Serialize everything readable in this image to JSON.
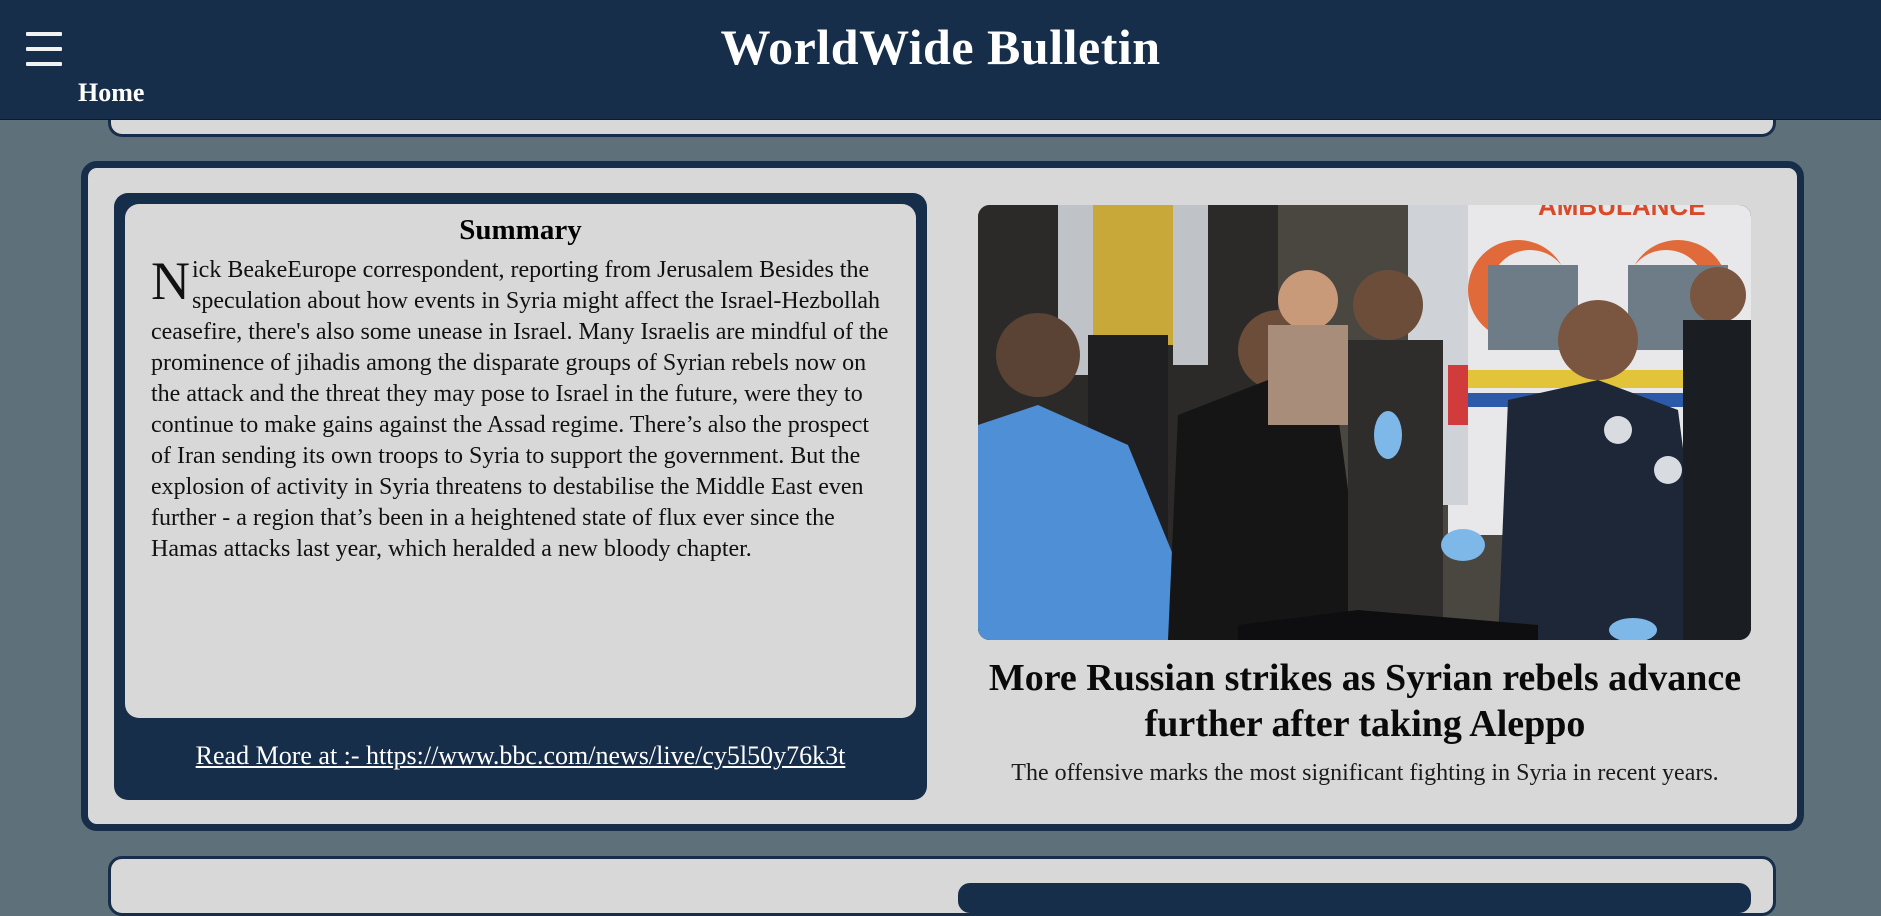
{
  "header": {
    "site_title": "WorldWide Bulletin",
    "menu_icon": "hamburger-menu-icon",
    "nav_home": "Home",
    "background_color": "#172e4a"
  },
  "article": {
    "summary_heading": "Summary",
    "summary_drop_cap": "N",
    "summary_text": "ick BeakeEurope correspondent, reporting from Jerusalem Besides the speculation about how events in Syria might affect the Israel-Hezbollah ceasefire, there's also some unease in Israel. Many Israelis are mindful of the prominence of jihadis among the disparate groups of Syrian rebels now on the attack and the threat they may pose to Israel in the future, were they to continue to make gains against the Assad regime. There’s also the prospect of Iran sending its own troops to Syria to support the government. But the explosion of activity in Syria threatens to destabilise the Middle East even further - a region that’s been in a heightened state of flux ever since the Hamas attacks last year, which heralded a new bloody chapter.",
    "read_more": "Read More at :- https://www.bbc.com/news/live/cy5l50y76k3t",
    "photo_text": "AMBULANCE",
    "headline": "More Russian strikes as Syrian rebels advance further after taking Aleppo",
    "subheadline": "The offensive marks the most significant fighting in Syria in recent years."
  },
  "colors": {
    "page_background": "#5e707a",
    "card_background": "#d8d8d8",
    "accent_navy": "#172e4a"
  }
}
